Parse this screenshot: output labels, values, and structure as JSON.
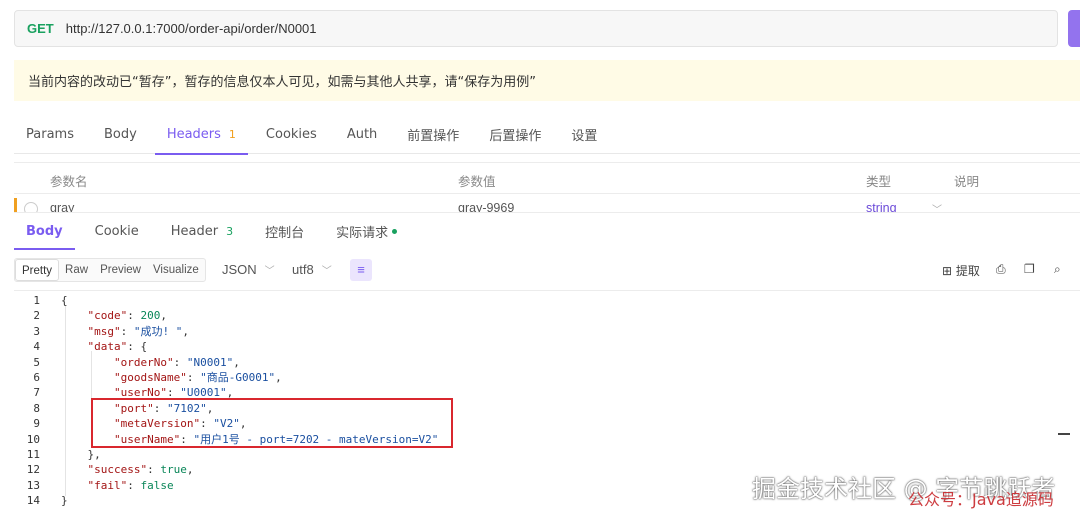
{
  "url_bar": {
    "method": "GET",
    "url": "http://127.0.0.1:7000/order-api/order/N0001"
  },
  "warning": "当前内容的改动已“暂存”，暂存的信息仅本人可见，如需与其他人共享，请“保存为用例”",
  "request_tabs": [
    {
      "label": "Params"
    },
    {
      "label": "Body"
    },
    {
      "label": "Headers",
      "count": "1"
    },
    {
      "label": "Cookies"
    },
    {
      "label": "Auth"
    },
    {
      "label": "前置操作"
    },
    {
      "label": "后置操作"
    },
    {
      "label": "设置"
    }
  ],
  "header_table": {
    "columns": [
      "参数名",
      "参数值",
      "类型",
      "说明"
    ],
    "row": {
      "name": "gray",
      "value": "gray-9969",
      "type": "string"
    }
  },
  "response_tabs": [
    {
      "label": "Body"
    },
    {
      "label": "Cookie"
    },
    {
      "label": "Header",
      "count": "3"
    },
    {
      "label": "控制台"
    },
    {
      "label": "实际请求"
    }
  ],
  "view_modes": [
    "Pretty",
    "Raw",
    "Preview",
    "Visualize"
  ],
  "format": "JSON",
  "encoding": "utf8",
  "toolbar_right": {
    "extract": "提取"
  },
  "code_lines": [
    {
      "n": "1",
      "parts": [
        [
          "p",
          "{"
        ]
      ]
    },
    {
      "n": "2",
      "parts": [
        [
          "p",
          "    "
        ],
        [
          "k",
          "\"code\""
        ],
        [
          "p",
          ": "
        ],
        [
          "n",
          "200"
        ],
        [
          "p",
          ","
        ]
      ]
    },
    {
      "n": "3",
      "parts": [
        [
          "p",
          "    "
        ],
        [
          "k",
          "\"msg\""
        ],
        [
          "p",
          ": "
        ],
        [
          "s",
          "\"成功! \""
        ],
        [
          "p",
          ","
        ]
      ]
    },
    {
      "n": "4",
      "parts": [
        [
          "p",
          "    "
        ],
        [
          "k",
          "\"data\""
        ],
        [
          "p",
          ": {"
        ]
      ]
    },
    {
      "n": "5",
      "parts": [
        [
          "p",
          "        "
        ],
        [
          "k",
          "\"orderNo\""
        ],
        [
          "p",
          ": "
        ],
        [
          "s",
          "\"N0001\""
        ],
        [
          "p",
          ","
        ]
      ]
    },
    {
      "n": "6",
      "parts": [
        [
          "p",
          "        "
        ],
        [
          "k",
          "\"goodsName\""
        ],
        [
          "p",
          ": "
        ],
        [
          "s",
          "\"商品-G0001\""
        ],
        [
          "p",
          ","
        ]
      ]
    },
    {
      "n": "7",
      "parts": [
        [
          "p",
          "        "
        ],
        [
          "k",
          "\"userNo\""
        ],
        [
          "p",
          ": "
        ],
        [
          "s",
          "\"U0001\""
        ],
        [
          "p",
          ","
        ]
      ]
    },
    {
      "n": "8",
      "parts": [
        [
          "p",
          "        "
        ],
        [
          "k",
          "\"port\""
        ],
        [
          "p",
          ": "
        ],
        [
          "s",
          "\"7102\""
        ],
        [
          "p",
          ","
        ]
      ]
    },
    {
      "n": "9",
      "parts": [
        [
          "p",
          "        "
        ],
        [
          "k",
          "\"metaVersion\""
        ],
        [
          "p",
          ": "
        ],
        [
          "s",
          "\"V2\""
        ],
        [
          "p",
          ","
        ]
      ]
    },
    {
      "n": "10",
      "parts": [
        [
          "p",
          "        "
        ],
        [
          "k",
          "\"userName\""
        ],
        [
          "p",
          ": "
        ],
        [
          "s",
          "\"用户1号 - port=7202 - mateVersion=V2\""
        ]
      ]
    },
    {
      "n": "11",
      "parts": [
        [
          "p",
          "    },"
        ]
      ]
    },
    {
      "n": "12",
      "parts": [
        [
          "p",
          "    "
        ],
        [
          "k",
          "\"success\""
        ],
        [
          "p",
          ": "
        ],
        [
          "n",
          "true"
        ],
        [
          "p",
          ","
        ]
      ]
    },
    {
      "n": "13",
      "parts": [
        [
          "p",
          "    "
        ],
        [
          "k",
          "\"fail\""
        ],
        [
          "p",
          ": "
        ],
        [
          "n",
          "false"
        ]
      ]
    },
    {
      "n": "14",
      "parts": [
        [
          "p",
          "}"
        ]
      ]
    }
  ],
  "watermark": {
    "line1": "掘金技术社区 @ 字节跳跃者",
    "line2": "公众号：Java追源码"
  },
  "colors": {
    "accent": "#7a5cf0",
    "method_get": "#19a15f",
    "highlight_box": "#d9272e",
    "warning_bg": "#fffbe6"
  }
}
